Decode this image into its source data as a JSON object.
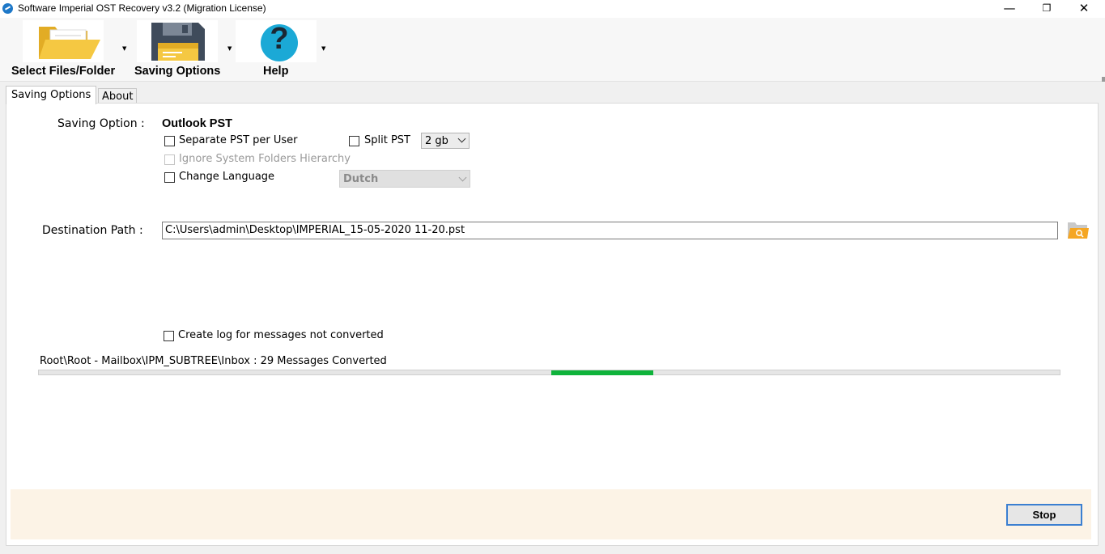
{
  "window": {
    "title": "Software Imperial OST Recovery v3.2 (Migration License)",
    "min_glyph": "—",
    "max_glyph": "❐",
    "close_glyph": "✕"
  },
  "toolbar": {
    "select_files_label": "Select Files/Folder",
    "saving_options_label": "Saving Options",
    "help_label": "Help",
    "dropdown_arrow": "▼",
    "help_glyph": "?"
  },
  "tabs": [
    {
      "label": "Saving Options",
      "active": true
    },
    {
      "label": "About",
      "active": false
    }
  ],
  "saving": {
    "option_label": "Saving Option :",
    "option_value": "Outlook PST",
    "separate_pst_label": "Separate PST per User",
    "separate_pst_checked": false,
    "split_pst_label": "Split PST",
    "split_pst_checked": false,
    "split_size_value": "2 gb",
    "ignore_hierarchy_label": "Ignore System Folders Hierarchy",
    "ignore_hierarchy_enabled": false,
    "change_language_label": "Change Language",
    "change_language_checked": false,
    "language_value": "Dutch"
  },
  "destination": {
    "label": "Destination Path :",
    "value": "C:\\Users\\admin\\Desktop\\IMPERIAL_15-05-2020 11-20.pst"
  },
  "log": {
    "create_log_label": "Create log for messages not converted",
    "checked": false
  },
  "status": {
    "text": "Root\\Root - Mailbox\\IPM_SUBTREE\\Inbox : 29 Messages Converted"
  },
  "progress": {
    "style": "marquee",
    "chunk_start_fraction": 0.502,
    "chunk_width_fraction": 0.1
  },
  "actions": {
    "stop_label": "Stop"
  },
  "colors": {
    "accent_blue": "#3b7fd1",
    "progress_green": "#0fb33b",
    "folder_yellow": "#f5c842",
    "help_cyan": "#1ba9d6",
    "bottom_bar": "#fcf3e6"
  }
}
